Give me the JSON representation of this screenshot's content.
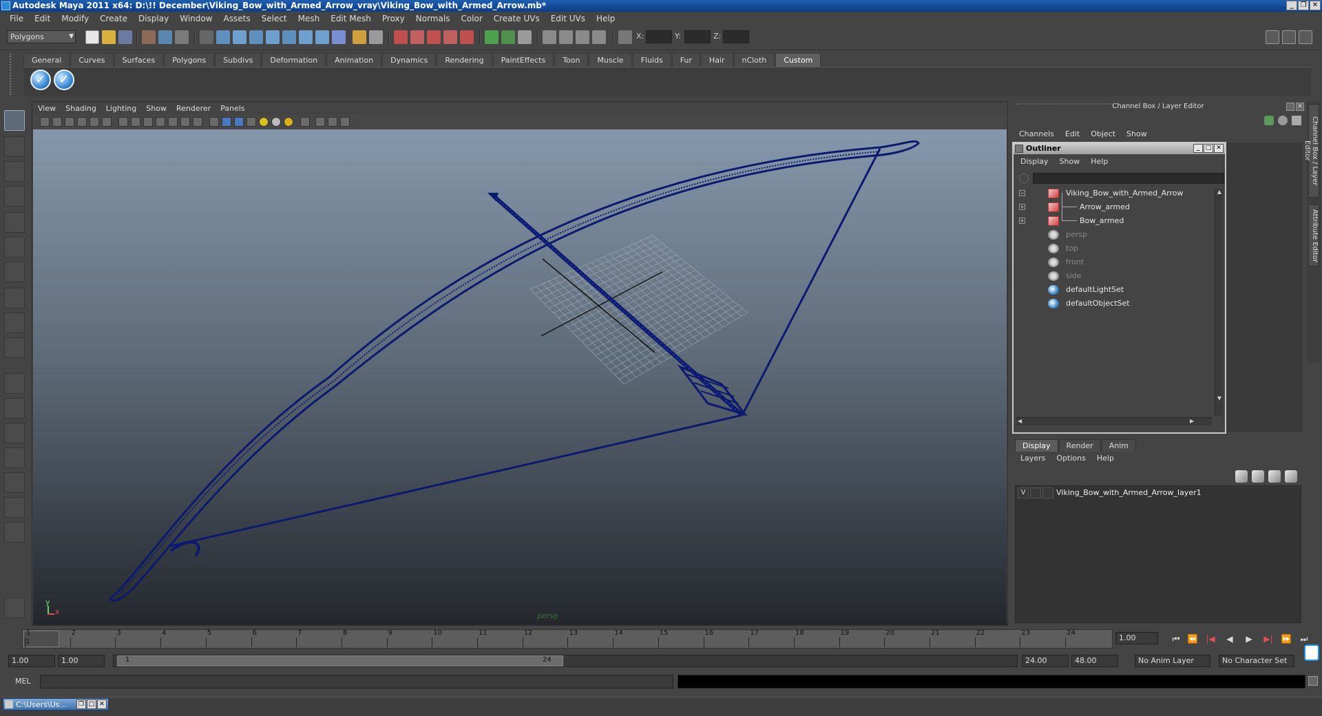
{
  "window": {
    "title": "Autodesk Maya 2011 x64: D:\\!! December\\Viking_Bow_with_Armed_Arrow_vray\\Viking_Bow_with_Armed_Arrow.mb*",
    "min": "_",
    "restore": "❐",
    "close": "✕"
  },
  "menubar": [
    "File",
    "Edit",
    "Modify",
    "Create",
    "Display",
    "Window",
    "Assets",
    "Select",
    "Mesh",
    "Edit Mesh",
    "Proxy",
    "Normals",
    "Color",
    "Create UVs",
    "Edit UVs",
    "Help"
  ],
  "statusline": {
    "mode": "Polygons",
    "x_label": "X:",
    "y_label": "Y:",
    "z_label": "Z:"
  },
  "shelf": {
    "tabs": [
      "General",
      "Curves",
      "Surfaces",
      "Polygons",
      "Subdivs",
      "Deformation",
      "Animation",
      "Dynamics",
      "Rendering",
      "PaintEffects",
      "Toon",
      "Muscle",
      "Fluids",
      "Fur",
      "Hair",
      "nCloth",
      "Custom"
    ],
    "active_tab": "Custom",
    "check_glyph": "✓"
  },
  "viewport": {
    "menu": [
      "View",
      "Shading",
      "Lighting",
      "Show",
      "Renderer",
      "Panels"
    ],
    "camera_label": "persp",
    "axis_y": "y",
    "axis_x": "x",
    "colors": {
      "wire": "#0b1a6e",
      "grid": "#9aa4b0",
      "grid_axis": "#111111"
    }
  },
  "channelbox": {
    "title": "Channel Box / Layer Editor",
    "menu": [
      "Channels",
      "Edit",
      "Object",
      "Show"
    ],
    "vtab_channel": "Channel Box / Layer Editor",
    "vtab_attribute": "Attribute Editor"
  },
  "outliner": {
    "title": "Outliner",
    "menu": [
      "Display",
      "Show",
      "Help"
    ],
    "items": [
      {
        "label": "Viking_Bow_with_Armed_Arrow",
        "type": "mesh",
        "expander": "−",
        "indent": 0,
        "dim": false
      },
      {
        "label": "Arrow_armed",
        "type": "mesh",
        "expander": "+",
        "indent": 1,
        "dim": false
      },
      {
        "label": "Bow_armed",
        "type": "mesh",
        "expander": "+",
        "indent": 1,
        "dim": false
      },
      {
        "label": "persp",
        "type": "cam",
        "expander": "",
        "indent": 0,
        "dim": true
      },
      {
        "label": "top",
        "type": "cam",
        "expander": "",
        "indent": 0,
        "dim": true
      },
      {
        "label": "front",
        "type": "cam",
        "expander": "",
        "indent": 0,
        "dim": true
      },
      {
        "label": "side",
        "type": "cam",
        "expander": "",
        "indent": 0,
        "dim": true
      },
      {
        "label": "defaultLightSet",
        "type": "set",
        "expander": "",
        "indent": 0,
        "dim": false
      },
      {
        "label": "defaultObjectSet",
        "type": "set",
        "expander": "",
        "indent": 0,
        "dim": false
      }
    ]
  },
  "layereditor": {
    "tabs": [
      "Display",
      "Render",
      "Anim"
    ],
    "active_tab": "Display",
    "menu": [
      "Layers",
      "Options",
      "Help"
    ],
    "layer": {
      "visible": "V",
      "name": "Viking_Bow_with_Armed_Arrow_layer1"
    }
  },
  "timeslider": {
    "ticks": [
      "1",
      "2",
      "3",
      "4",
      "5",
      "6",
      "7",
      "8",
      "9",
      "10",
      "11",
      "12",
      "13",
      "14",
      "15",
      "16",
      "17",
      "18",
      "19",
      "20",
      "21",
      "22",
      "23",
      "24"
    ],
    "current_frame_label": "1",
    "current_time": "1.00",
    "playback": [
      "⏮",
      "⏪",
      "|◀",
      "◀",
      "▶",
      "▶|",
      "⏩",
      "⏭"
    ]
  },
  "rangeslider": {
    "start_time": "1.00",
    "playback_start": "1.00",
    "range_lo": "1",
    "range_hi": "24",
    "playback_end": "24.00",
    "end_time": "48.00",
    "anim_layer": "No Anim Layer",
    "character_set": "No Character Set"
  },
  "commandline": {
    "label": "MEL"
  },
  "taskbar": {
    "item": "C:\\Users\\Us...",
    "restore": "❐",
    "max": "□",
    "close": "✕"
  }
}
